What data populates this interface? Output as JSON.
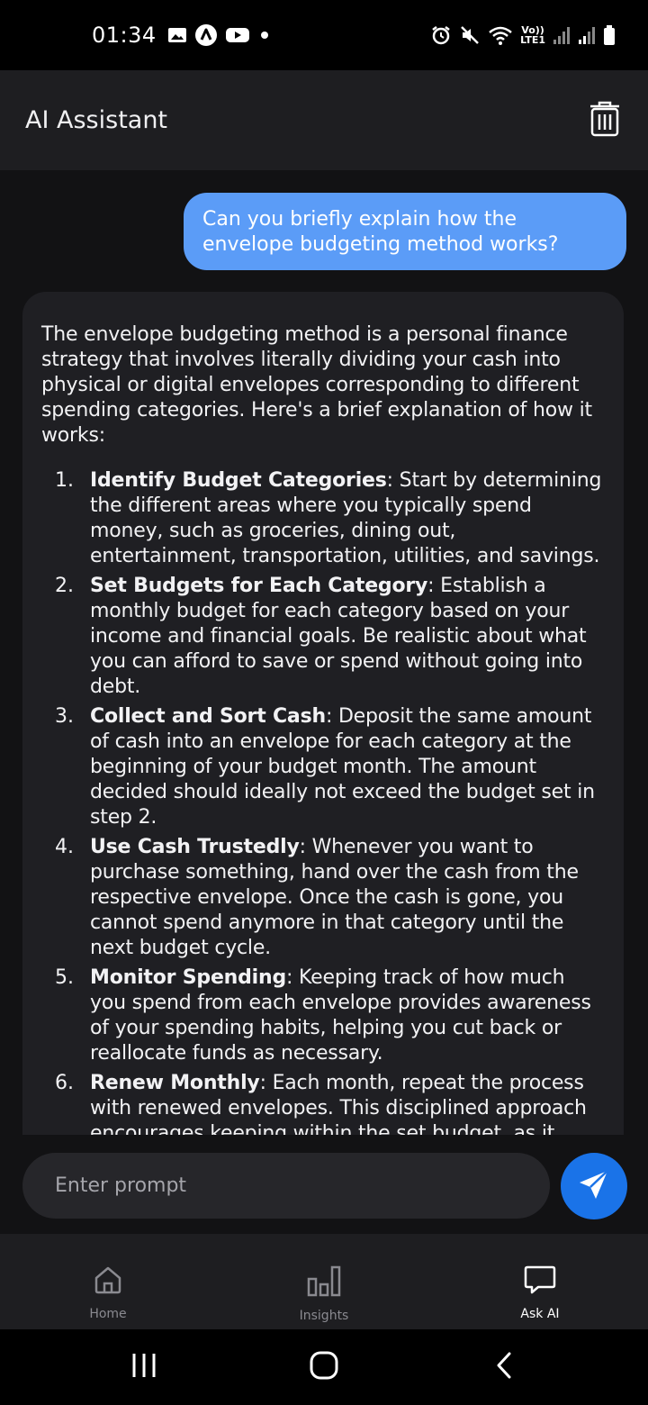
{
  "status_bar": {
    "time": "01:34",
    "left_icons": [
      "gallery-icon",
      "app-badge-icon",
      "youtube-icon",
      "dot-icon"
    ],
    "lte_label_top": "Vo))",
    "lte_label_bottom": "LTE1",
    "right_icons": [
      "alarm-icon",
      "mute-icon",
      "wifi-icon",
      "signal-icon",
      "signal-icon",
      "battery-icon"
    ]
  },
  "header": {
    "title": "AI Assistant",
    "action_icon": "trash-icon"
  },
  "chat": {
    "user_message": "Can you briefly explain how the envelope budgeting method works?",
    "ai_intro": "The envelope budgeting method is a personal finance strategy that involves literally dividing your cash into physical or digital envelopes corresponding to different spending categories. Here's a brief explanation of how it works:",
    "steps": [
      {
        "num": "1.",
        "title": "Identify Budget Categories",
        "text": ": Start by determining the different areas where you typically spend money, such as groceries, dining out, entertainment, transportation, utilities, and savings."
      },
      {
        "num": "2.",
        "title": "Set Budgets for Each Category",
        "text": ": Establish a monthly budget for each category based on your income and financial goals. Be realistic about what you can afford to save or spend without going into debt."
      },
      {
        "num": "3.",
        "title": "Collect and Sort Cash",
        "text": ": Deposit the same amount of cash into an envelope for each category at the beginning of your budget month. The amount decided should ideally not exceed the budget set in step 2."
      },
      {
        "num": "4.",
        "title": "Use Cash Trustedly",
        "text": ": Whenever you want to purchase something, hand over the cash from the respective envelope. Once the cash is gone, you cannot spend anymore in that category until the next budget cycle."
      },
      {
        "num": "5.",
        "title": "Monitor Spending",
        "text": ": Keeping track of how much you spend from each envelope provides awareness of your spending habits, helping you cut back or reallocate funds as necessary."
      },
      {
        "num": "6.",
        "title": "Renew Monthly",
        "text": ": Each month, repeat the process with renewed envelopes. This disciplined approach encourages keeping within the set budget, as it imitates the constraints of having limited physical"
      }
    ]
  },
  "input": {
    "placeholder": "Enter prompt",
    "value": "",
    "send_icon": "send-icon"
  },
  "bottom_nav": {
    "items": [
      {
        "label": "Home",
        "icon": "home-icon",
        "active": false
      },
      {
        "label": "Insights",
        "icon": "bar-chart-icon",
        "active": false
      },
      {
        "label": "Ask AI",
        "icon": "chat-bubble-icon",
        "active": true
      }
    ]
  },
  "system_nav": {
    "buttons": [
      "recents-icon",
      "home-circle-icon",
      "back-icon"
    ]
  },
  "colors": {
    "accent": "#1a73e8",
    "user_bubble": "#5b9cf7",
    "ai_bubble": "#1f1f23",
    "background": "#121214",
    "header": "#1e1e21"
  }
}
